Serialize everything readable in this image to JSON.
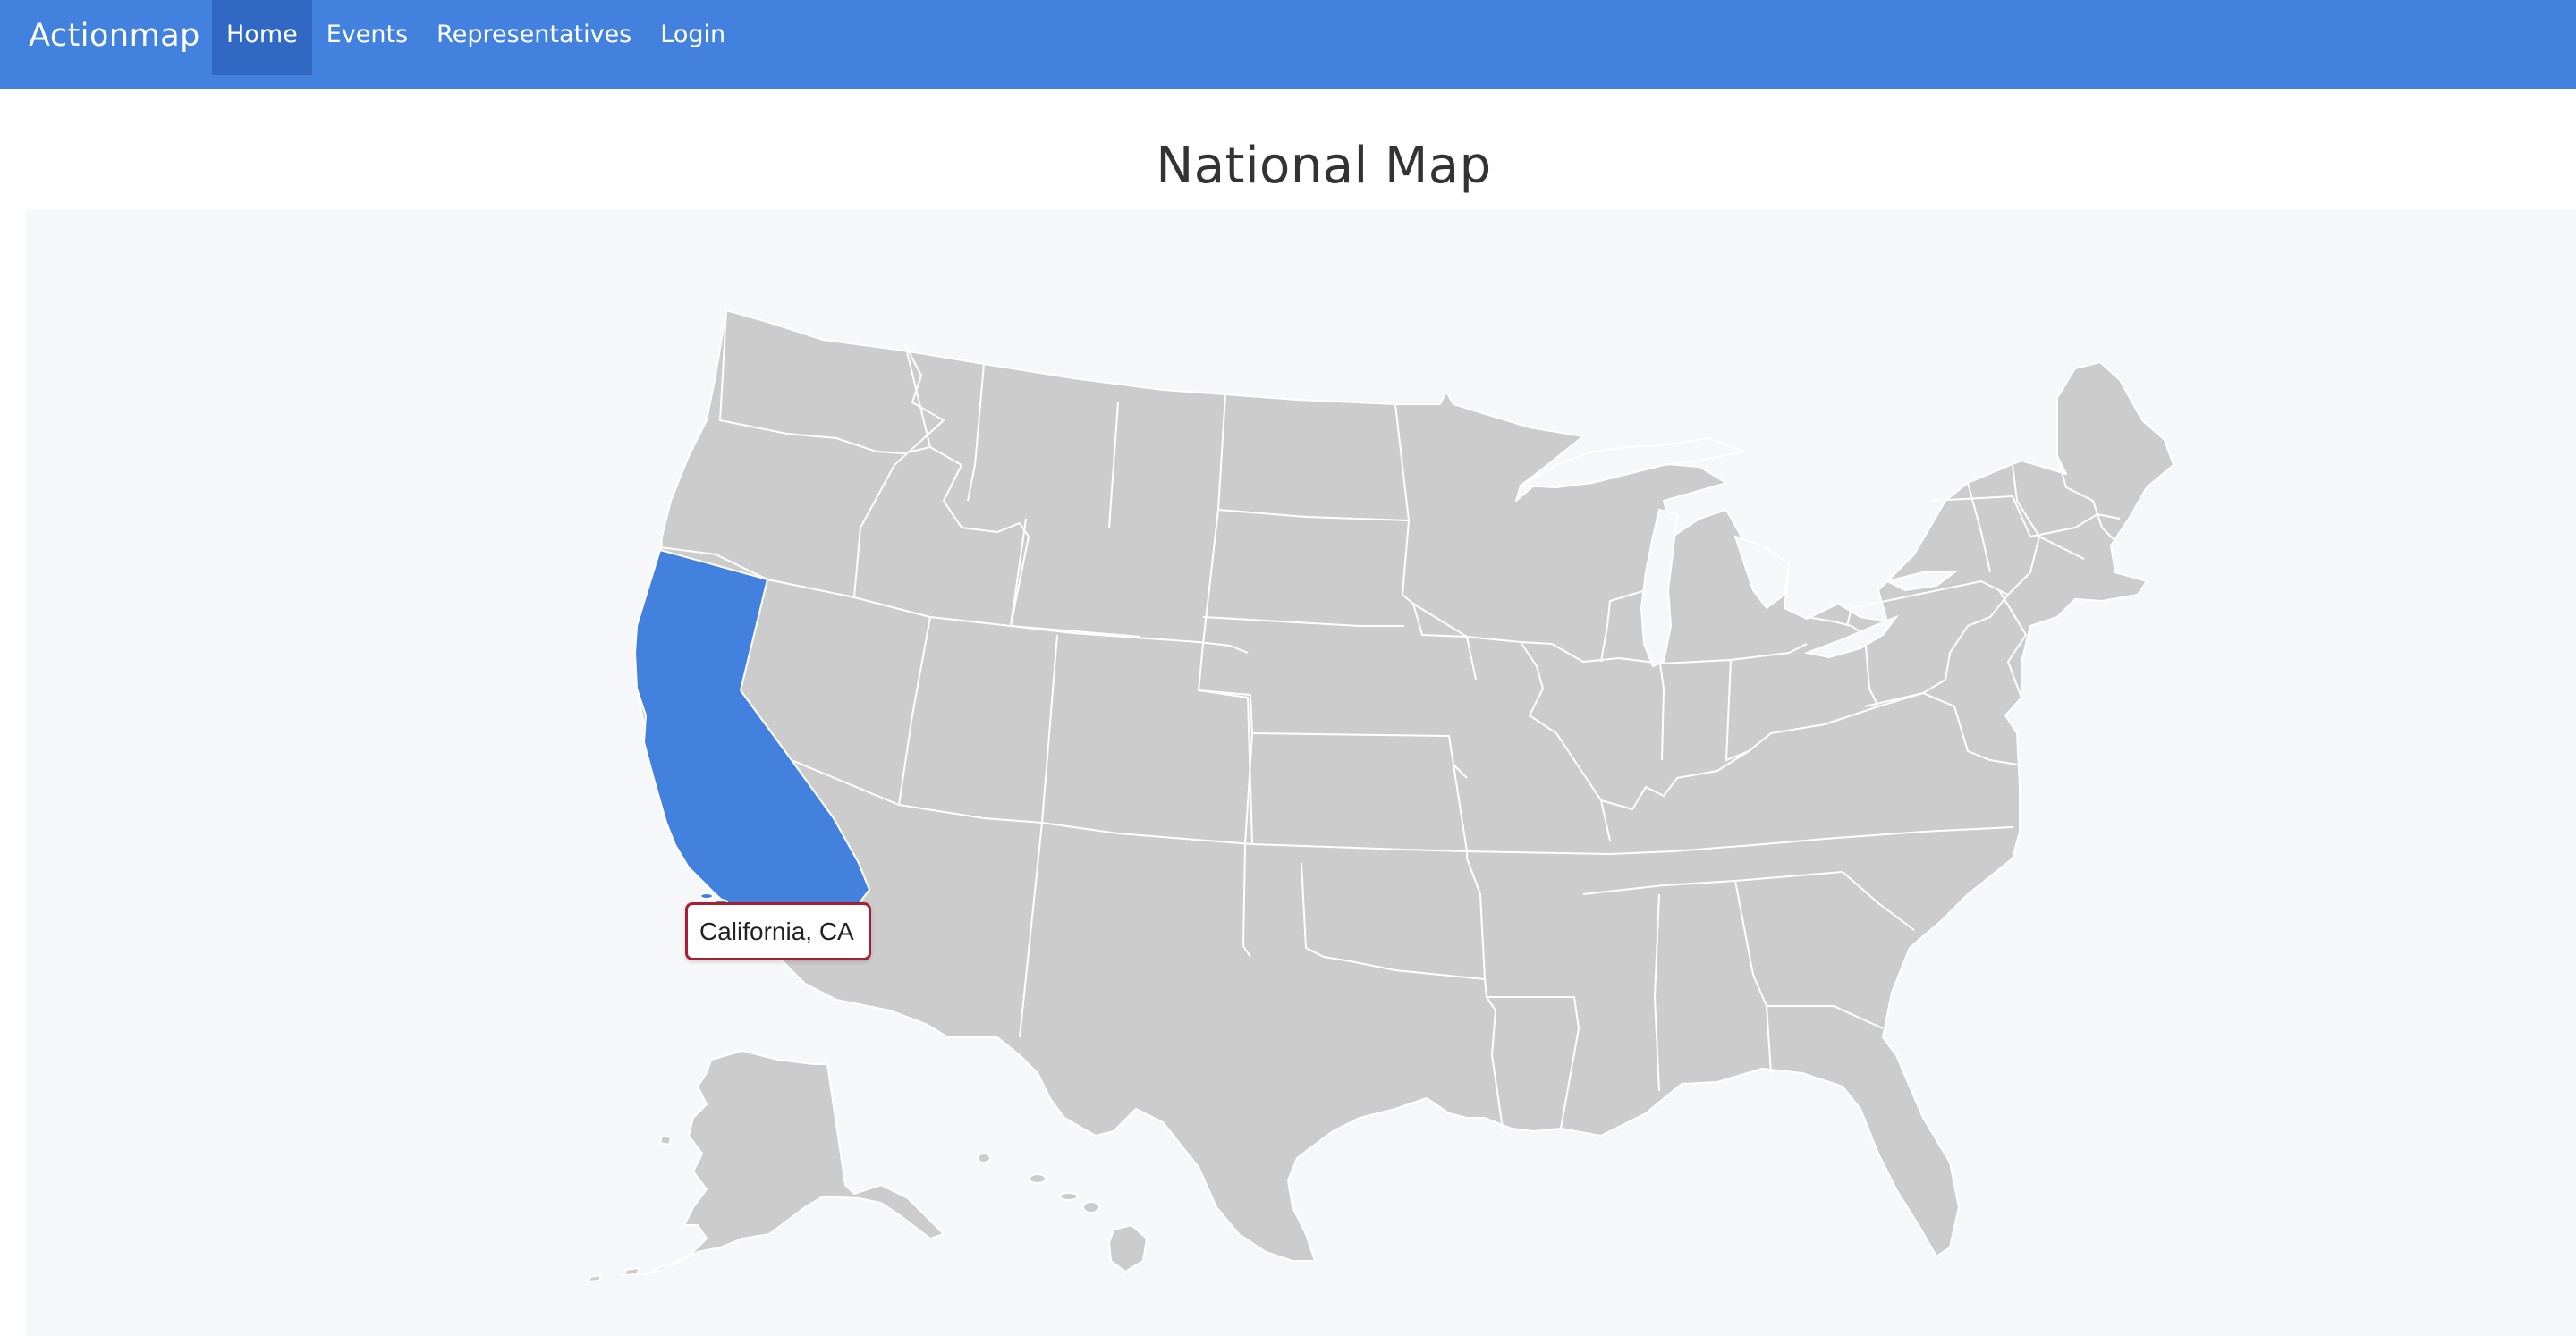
{
  "navbar": {
    "brand": "Actionmap",
    "items": [
      {
        "label": "Home",
        "active": true
      },
      {
        "label": "Events",
        "active": false
      },
      {
        "label": "Representatives",
        "active": false
      },
      {
        "label": "Login",
        "active": false
      }
    ]
  },
  "page_title": "National Map",
  "map": {
    "highlighted_state": "California",
    "tooltip": "California, CA",
    "colors": {
      "navbar": "#4281de",
      "state_fill": "#cccccc",
      "state_highlight": "#4281de",
      "state_border": "#ffffff",
      "tooltip_border": "#a81f33",
      "map_background": "#f6f7f9"
    }
  }
}
